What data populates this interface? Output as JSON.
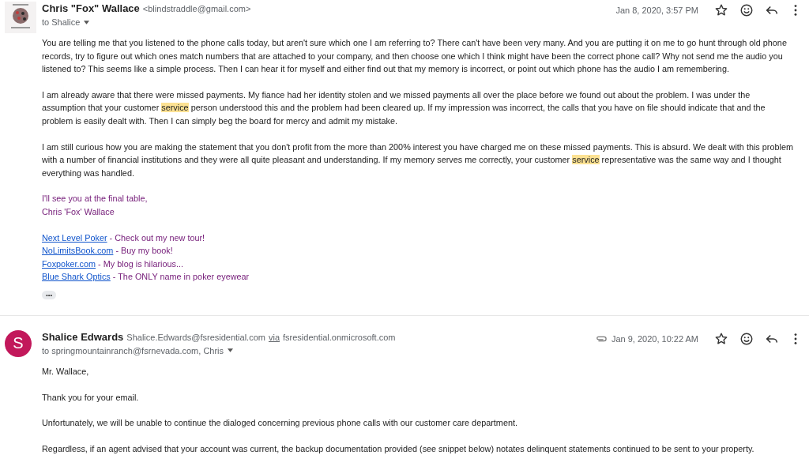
{
  "messages": [
    {
      "sender": "Chris \"Fox\" Wallace",
      "email": "<blindstraddle@gmail.com>",
      "recipients": "to Shalice",
      "date": "Jan 8, 2020, 3:57 PM",
      "attachment": false,
      "paragraphs": [
        {
          "kind": "text",
          "segments": [
            {
              "text": "You are telling me that you listened to the phone calls today, but aren't sure which one I am referring to? There can't have been very many. And you are putting it on me to go hunt through old phone records, try to figure out which ones match numbers that are attached to your company, and then choose one which I think might have been the correct phone call? Why not send me the audio you listened to? This seems like a simple process. Then I can hear it for myself and either find out that my memory is incorrect, or point out which phone has the audio I am remembering.",
              "highlighted": false
            }
          ]
        },
        {
          "kind": "text",
          "segments": [
            {
              "text": "I am already aware that there were missed payments. My fiance had her identity stolen and we missed payments all over the place before we found out about the problem. I was under the assumption that your customer ",
              "highlighted": false
            },
            {
              "text": "service",
              "highlighted": true
            },
            {
              "text": " person understood this and the problem had been cleared up. If my impression was incorrect, the calls that you have on file should indicate that and the problem is easily dealt with. Then I can simply beg the board for mercy and admit my mistake.",
              "highlighted": false
            }
          ]
        },
        {
          "kind": "text",
          "segments": [
            {
              "text": "I am still curious how you are making the statement that you don't profit from the more than 200% interest you have charged me on these missed payments. This is absurd. We dealt with this problem with a number of financial institutions and they were all quite pleasant and understanding. If my memory serves me correctly, your customer ",
              "highlighted": false
            },
            {
              "text": "service",
              "highlighted": true
            },
            {
              "text": " representative was the same way and I thought everything was handled.",
              "highlighted": false
            }
          ]
        },
        {
          "kind": "signature",
          "lines": [
            "I'll see you at the final table,",
            "Chris 'Fox' Wallace"
          ]
        },
        {
          "kind": "links",
          "items": [
            {
              "link": "Next Level Poker",
              "tail": " - Check out my new tour!"
            },
            {
              "link": "NoLimitsBook.com",
              "tail": " - Buy my book!"
            },
            {
              "link": "Foxpoker.com",
              "tail": " - My blog is hilarious..."
            },
            {
              "link": "Blue Shark Optics",
              "tail": " - The ONLY name in poker eyewear"
            }
          ]
        }
      ],
      "trimmed": "•••"
    },
    {
      "avatar": {
        "kind": "letter",
        "letter": "S",
        "color": "#c2185b"
      },
      "sender": "Shalice Edwards",
      "email": "Shalice.Edwards@fsresidential.com",
      "via": "via",
      "via_domain": "fsresidential.onmicrosoft.com",
      "recipients": "to springmountainranch@fsrnevada.com, Chris",
      "date": "Jan 9, 2020, 10:22 AM",
      "attachment": true,
      "paragraphs": [
        {
          "kind": "text",
          "segments": [
            {
              "text": "Mr. Wallace,",
              "highlighted": false
            }
          ]
        },
        {
          "kind": "text",
          "segments": [
            {
              "text": "Thank you for your email.",
              "highlighted": false
            }
          ]
        },
        {
          "kind": "text",
          "segments": [
            {
              "text": "Unfortunately, we will be unable to continue the dialoged concerning previous phone calls with our customer care department.",
              "highlighted": false
            }
          ]
        },
        {
          "kind": "text",
          "segments": [
            {
              "text": "Regardless, if an agent advised that your account was current, the backup documentation provided (see snippet below) notates delinquent statements continued to be sent to your property.",
              "highlighted": false
            }
          ]
        }
      ]
    }
  ]
}
